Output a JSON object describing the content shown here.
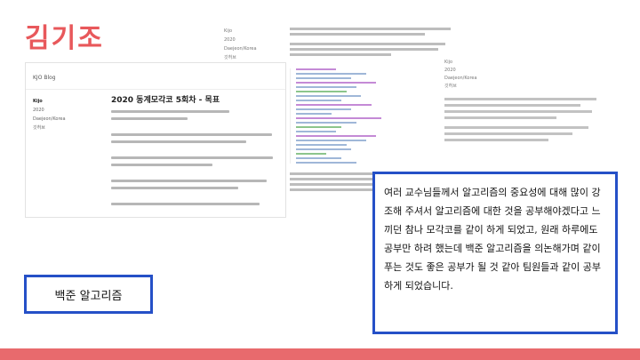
{
  "slide": {
    "title": "김기조",
    "accent_color": "#e8585b",
    "box_color": "#2550c7",
    "bottom_bar_color": "#e86a6d"
  },
  "left_screenshot": {
    "brand": "KJO Blog",
    "sidebar": {
      "name": "Kijo",
      "lines": [
        "2020",
        "Daejeon/Korea",
        "깃허브"
      ]
    },
    "post_title": "2020 동계모각코 5회차 - 목표"
  },
  "right_screenshot": {
    "meta": [
      "Kijo",
      "2020",
      "Daejeon/Korea",
      "깃허브"
    ],
    "side_meta": [
      "Kijo",
      "2020",
      "Daejeon/Korea",
      "깃허브"
    ]
  },
  "callouts": {
    "small": "백준 알고리즘",
    "big": "여러 교수님들께서 알고리즘의 중요성에 대해 많이 강조해 주셔서 알고리즘에 대한 것을 공부해야겠다고 느끼던 참나 모각코를 같이 하게 되었고, 원래 하루에도 공부만 하려 했는데 백준 알고리즘을 의논해가며 같이 푸는 것도 좋은 공부가 될 것 같아 팀원들과 같이 공부하게 되었습니다."
  }
}
